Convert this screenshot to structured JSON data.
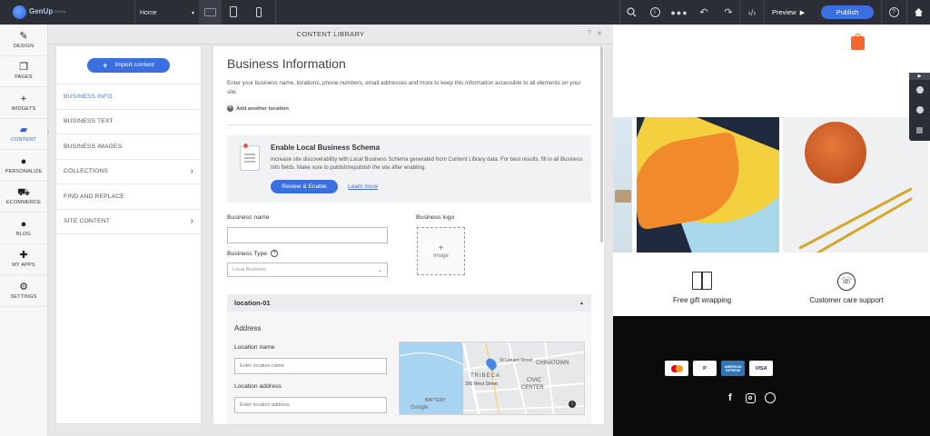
{
  "topbar": {
    "logo": "GenUp",
    "logo_sub": "DIGITAL",
    "page_select": "Home",
    "preview_label": "Preview",
    "publish_label": "Publish"
  },
  "nav": {
    "items": [
      {
        "label": "DESIGN",
        "icon": "brush-icon",
        "glyph": "✎"
      },
      {
        "label": "PAGES",
        "icon": "pages-icon",
        "glyph": "❐"
      },
      {
        "label": "WIDGETS",
        "icon": "plus-icon",
        "glyph": "+"
      },
      {
        "label": "CONTENT",
        "icon": "folder-icon",
        "glyph": "▰"
      },
      {
        "label": "PERSONALIZE",
        "icon": "person-icon",
        "glyph": "●"
      },
      {
        "label": "ECOMMERCE",
        "icon": "cart-icon",
        "glyph": "⛟"
      },
      {
        "label": "BLOG",
        "icon": "chat-icon",
        "glyph": "●"
      },
      {
        "label": "MY APPS",
        "icon": "puzzle-icon",
        "glyph": "✚"
      },
      {
        "label": "SETTINGS",
        "icon": "gear-icon",
        "glyph": "⚙"
      }
    ]
  },
  "panel": {
    "title": "CONTENT LIBRARY",
    "help": "?",
    "close": "✕"
  },
  "menu": {
    "import_label": "Import content",
    "items": [
      {
        "label": "BUSINESS INFO",
        "arrow": ""
      },
      {
        "label": "BUSINESS TEXT",
        "arrow": ""
      },
      {
        "label": "BUSINESS IMAGES",
        "arrow": ""
      },
      {
        "label": "COLLECTIONS",
        "arrow": "›"
      },
      {
        "label": "FIND AND REPLACE",
        "arrow": ""
      },
      {
        "label": "SITE CONTENT",
        "arrow": "›"
      }
    ]
  },
  "form": {
    "heading": "Business Information",
    "intro": "Enter your business name, locations, phone numbers, email addresses and more to keep this information accessible to all elements on your site.",
    "add_location": "Add another location",
    "schema_title": "Enable Local Business Schema",
    "schema_text": "Increase site discoverability with Local Business Schema generated from Content Library data. For best results, fill in all Business Info fields. Make sure to publish/republish the site after enabling.",
    "review_label": "Review & Enable",
    "learn_more": "Learn more",
    "business_name_label": "Business name",
    "business_name_value": "",
    "business_type_label": "Business Type",
    "business_type_value": "Local Business",
    "business_logo_label": "Business logo",
    "image_label": "Image",
    "location_title": "location-01",
    "address_heading": "Address",
    "location_name_label": "Location name",
    "location_name_placeholder": "Enter location name",
    "location_address_label": "Location address",
    "location_address_placeholder": "Enter location address"
  },
  "map": {
    "labels": [
      "TRIBECA",
      "CIVIC",
      "CENTER",
      "CHINATOWN",
      "200 West Street",
      "BATTERY",
      "St Lenard Street",
      "Google"
    ]
  },
  "preview": {
    "features": [
      "Free gift wrapping",
      "Customer care support"
    ],
    "payments": [
      "PayPal",
      "AMERICAN EXPRESS",
      "VISA"
    ]
  },
  "colors": {
    "accent": "#3b6fe0",
    "topbar": "#2b2e35",
    "footer": "#0b0b0b"
  }
}
